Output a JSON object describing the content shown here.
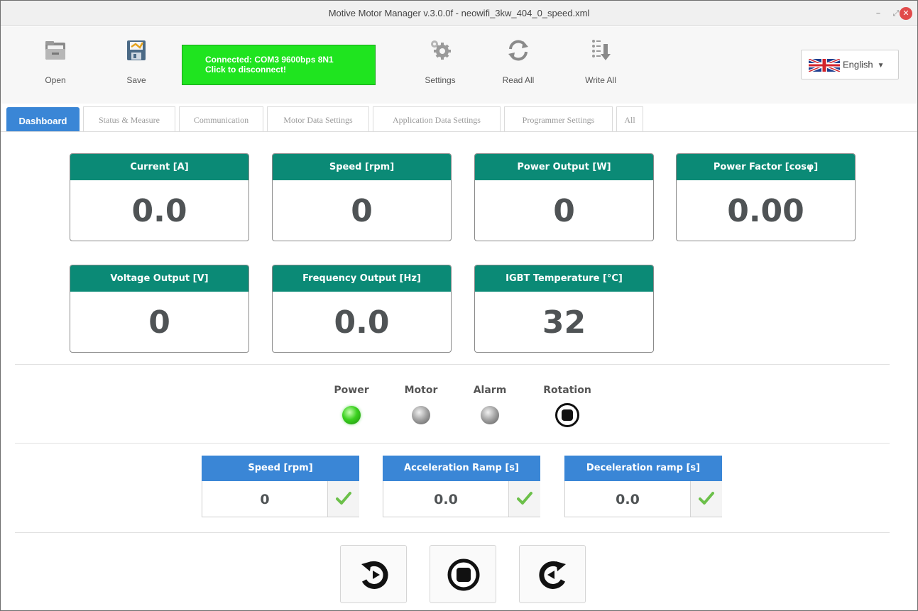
{
  "window": {
    "title": "Motive Motor Manager v.3.0.0f - neowifi_3kw_404_0_speed.xml",
    "minimize": "–",
    "restore": "⤢",
    "close": "✕"
  },
  "toolbar": {
    "open_label": "Open",
    "save_label": "Save",
    "connection_line1": "Connected: COM3 9600bps 8N1",
    "connection_line2": "Click to disconnect!",
    "settings_label": "Settings",
    "read_all_label": "Read All",
    "write_all_label": "Write All",
    "language": "English",
    "language_flag_icon": "uk-flag-icon"
  },
  "tabs": [
    {
      "label": "Dashboard",
      "active": true
    },
    {
      "label": "Status & Measure"
    },
    {
      "label": "Communication"
    },
    {
      "label": "Motor Data Settings"
    },
    {
      "label": "Application Data Settings"
    },
    {
      "label": "Programmer Settings"
    },
    {
      "label": "All"
    }
  ],
  "gauges": {
    "current": {
      "label": "Current [A]",
      "value": "0.0"
    },
    "speed": {
      "label": "Speed [rpm]",
      "value": "0"
    },
    "power_output": {
      "label": "Power Output [W]",
      "value": "0"
    },
    "power_factor": {
      "label": "Power Factor [cosφ]",
      "value": "0.00"
    },
    "voltage_output": {
      "label": "Voltage Output [V]",
      "value": "0"
    },
    "frequency_output": {
      "label": "Frequency Output [Hz]",
      "value": "0.0"
    },
    "igbt_temperature": {
      "label": "IGBT Temperature [°C]",
      "value": "32"
    }
  },
  "indicators": {
    "power": {
      "label": "Power",
      "state": "on",
      "color": "#3bd11f"
    },
    "motor": {
      "label": "Motor",
      "state": "off",
      "color": "#9e9e9e"
    },
    "alarm": {
      "label": "Alarm",
      "state": "off",
      "color": "#9e9e9e"
    },
    "rotation": {
      "label": "Rotation",
      "state": "stopped"
    }
  },
  "params": {
    "speed": {
      "label": "Speed [rpm]",
      "value": "0"
    },
    "acceleration": {
      "label": "Acceleration Ramp [s]",
      "value": "0.0"
    },
    "deceleration": {
      "label": "Deceleration ramp [s]",
      "value": "0.0"
    }
  },
  "controls": {
    "reverse_icon": "rotate-counterclockwise-icon",
    "stop_icon": "stop-icon",
    "forward_icon": "rotate-clockwise-icon"
  },
  "colors": {
    "gauge_header": "#0b8a76",
    "param_header": "#3a86d6",
    "connected": "#1fe41f",
    "active_tab": "#3a86d6"
  }
}
